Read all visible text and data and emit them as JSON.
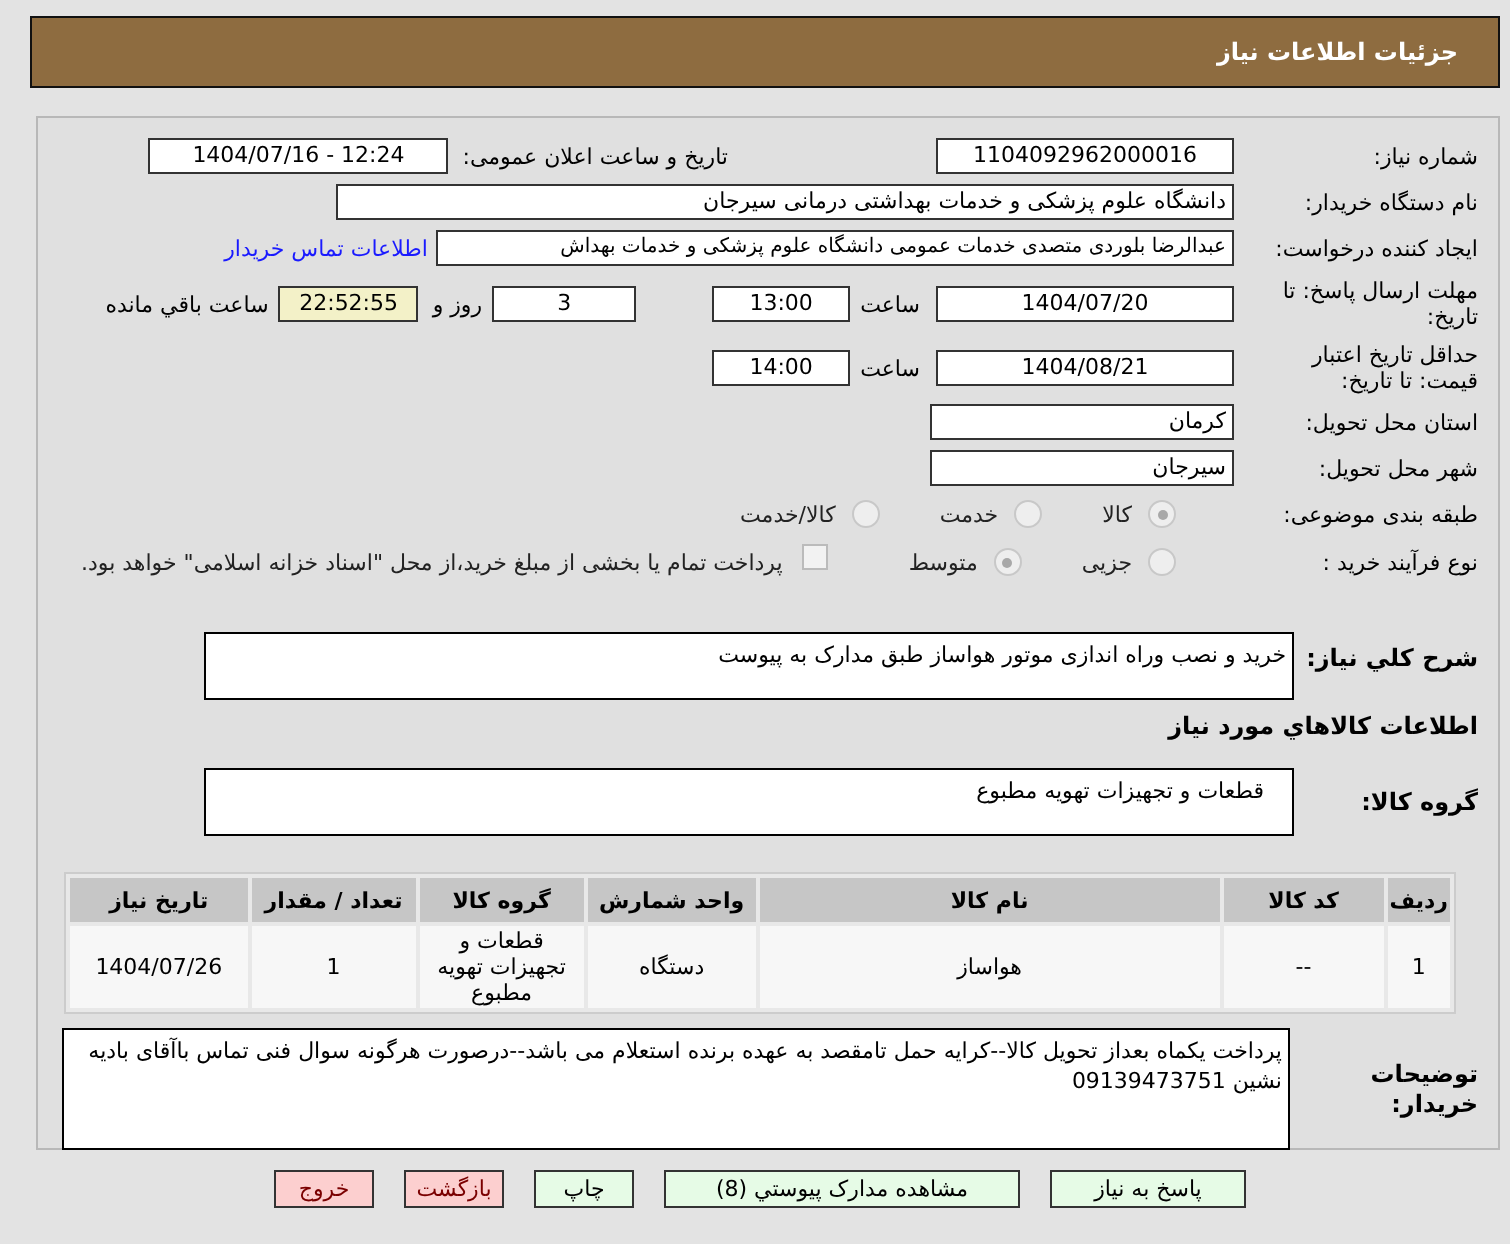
{
  "header": {
    "title": "جزئیات اطلاعات نیاز"
  },
  "need_number": {
    "label": "شماره نیاز:",
    "value": "1104092962000016"
  },
  "announce": {
    "label": "تاریخ و ساعت اعلان عمومی:",
    "value": "1404/07/16 - 12:24"
  },
  "buyer_org": {
    "label": "نام دستگاه خریدار:",
    "value": "دانشگاه علوم پزشکی و خدمات بهداشتی درمانی سیرجان"
  },
  "requester": {
    "label": "ایجاد کننده درخواست:",
    "value": "عبدالرضا بلوردی متصدی خدمات عمومی  دانشگاه علوم پزشکی و خدمات بهداش",
    "link": "اطلاعات تماس خریدار"
  },
  "reply_deadline": {
    "label": "مهلت ارسال پاسخ: تا تاریخ:",
    "date": "1404/07/20",
    "time_label": "ساعت",
    "time": "13:00",
    "days": "3",
    "days_label": "روز و",
    "remaining": "22:52:55",
    "remaining_label": "ساعت باقي مانده"
  },
  "price_validity": {
    "label": "حداقل تاریخ اعتبار قیمت: تا تاریخ:",
    "date": "1404/08/21",
    "time_label": "ساعت",
    "time": "14:00"
  },
  "province": {
    "label": "استان محل تحویل:",
    "value": "کرمان"
  },
  "city": {
    "label": "شهر محل تحویل:",
    "value": "سیرجان"
  },
  "category": {
    "label": "طبقه بندی موضوعی:",
    "options": [
      {
        "label": "کالا",
        "selected": true
      },
      {
        "label": "خدمت",
        "selected": false
      },
      {
        "label": "کالا/خدمت",
        "selected": false
      }
    ]
  },
  "process": {
    "label": "نوع فرآیند خرید :",
    "options": [
      {
        "label": "جزیی",
        "selected": false
      },
      {
        "label": "متوسط",
        "selected": true
      }
    ],
    "payment": {
      "label": "پرداخت تمام یا بخشی از مبلغ خرید،از محل \"اسناد خزانه اسلامی\" خواهد بود.",
      "checked": false
    }
  },
  "description": {
    "label": "شرح كلي نياز:",
    "value": "خرید و نصب وراه اندازی موتور هواساز طبق مدارک به پیوست"
  },
  "goods_heading": "اطلاعات كالاهاي مورد نياز",
  "goods_group": {
    "label": "گروه کالا:",
    "value": "قطعات و تجهیزات تهویه مطبوع"
  },
  "table": {
    "columns": [
      "ردیف",
      "کد کالا",
      "نام کالا",
      "واحد شمارش",
      "گروه کالا",
      "تعداد / مقدار",
      "تاریخ نیاز"
    ],
    "rows": [
      [
        "1",
        "--",
        "هواساز",
        "دستگاه",
        "قطعات و تجهیزات تهویه مطبوع",
        "1",
        "1404/07/26"
      ]
    ]
  },
  "buyer_notes": {
    "label": "توضیحات خریدار:",
    "value": "پرداخت یکماه بعداز تحویل کالا--کرایه حمل تامقصد به عهده برنده استعلام می باشد--درصورت هرگونه سوال فنی تماس باآقای بادیه نشین 09139473751"
  },
  "buttons": [
    {
      "label": "پاسخ به نیاز",
      "kind": "normal"
    },
    {
      "label": "مشاهده مدارک پیوستي (8)",
      "kind": "normal"
    },
    {
      "label": "چاپ",
      "kind": "normal"
    },
    {
      "label": "بازگشت",
      "kind": "danger"
    },
    {
      "label": "خروج",
      "kind": "danger"
    }
  ]
}
